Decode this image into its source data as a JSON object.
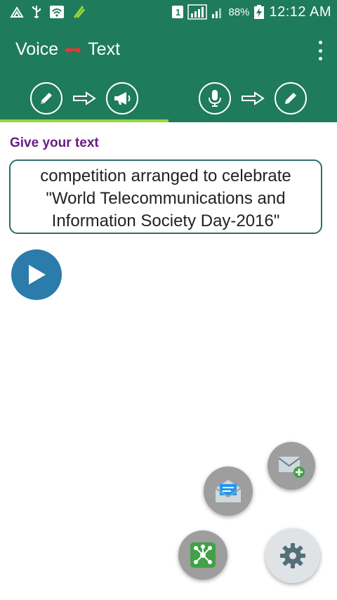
{
  "status_bar": {
    "sim_slot": "1",
    "battery": "88%",
    "time": "12:12 AM"
  },
  "app_bar": {
    "title_left": "Voice",
    "title_right": "Text"
  },
  "tabs": [
    {
      "from_icon": "pencil-icon",
      "to_icon": "megaphone-icon"
    },
    {
      "from_icon": "microphone-icon",
      "to_icon": "pencil-icon"
    }
  ],
  "content": {
    "section_label": "Give your text",
    "text_lines": [
      "competition arranged to celebrate",
      "\"World Telecommunications and",
      "Information Society Day-2016\""
    ]
  },
  "colors": {
    "primary": "#1e7b5b",
    "accent": "#9ad63b",
    "label": "#6a1b84",
    "play": "#2b7bab"
  }
}
